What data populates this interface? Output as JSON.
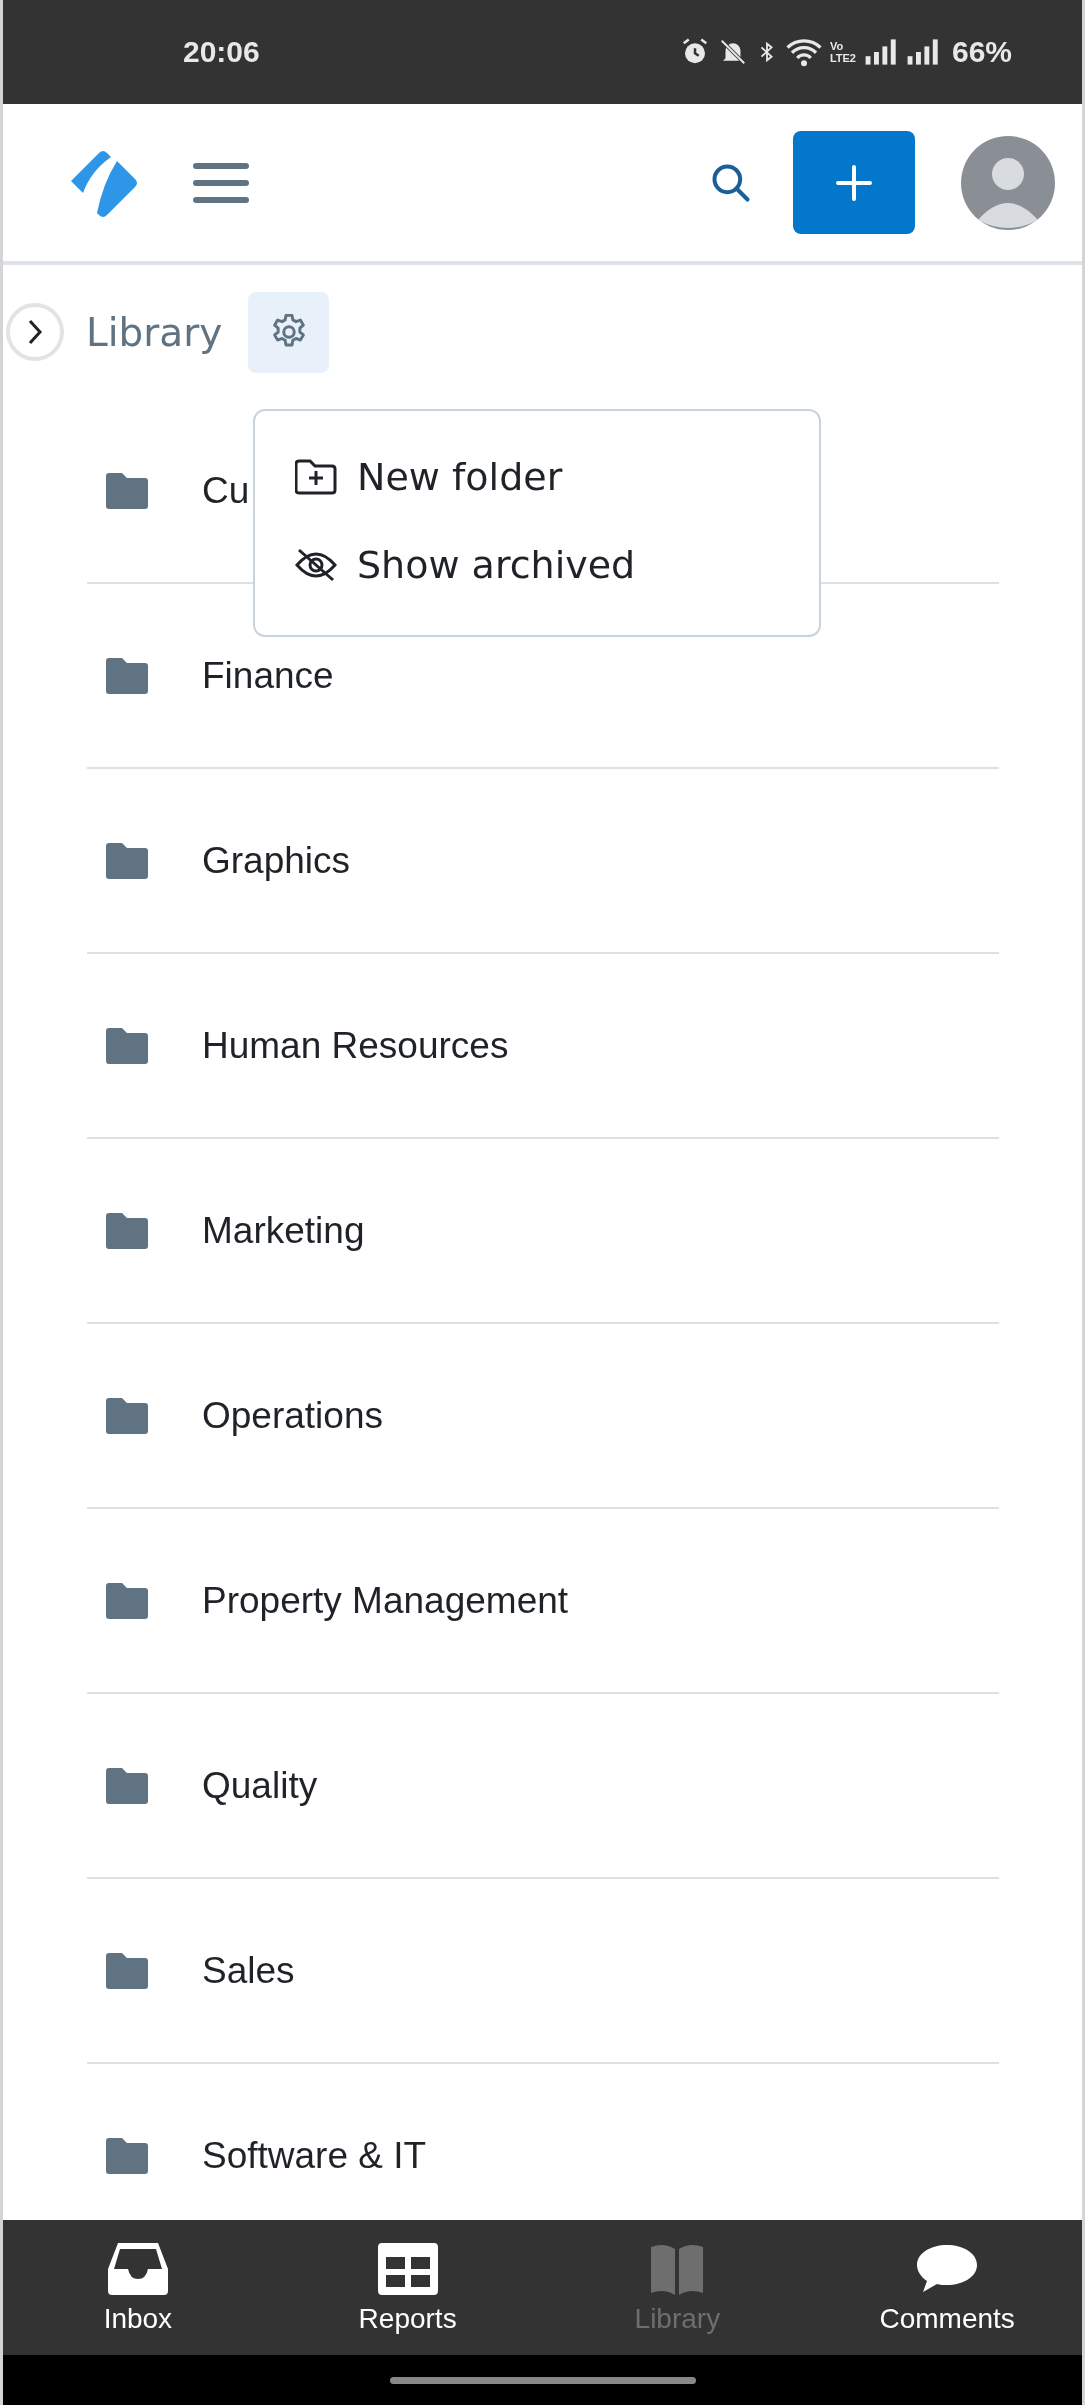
{
  "status_bar": {
    "time": "20:06",
    "network_label": [
      "Vo",
      "LTE2"
    ],
    "battery": "66%"
  },
  "breadcrumb": {
    "title": "Library"
  },
  "settings_menu": {
    "items": [
      {
        "kind": "new-folder",
        "label": "New folder"
      },
      {
        "kind": "archive",
        "label": "Show archived"
      }
    ]
  },
  "folders": [
    {
      "name": "Cu"
    },
    {
      "name": "Finance"
    },
    {
      "name": "Graphics"
    },
    {
      "name": "Human Resources"
    },
    {
      "name": "Marketing"
    },
    {
      "name": "Operations"
    },
    {
      "name": "Property Management"
    },
    {
      "name": "Quality"
    },
    {
      "name": "Sales"
    },
    {
      "name": "Software & IT"
    }
  ],
  "bottom_nav": [
    {
      "kind": "inbox",
      "label": "Inbox",
      "selected": false
    },
    {
      "kind": "reports",
      "label": "Reports",
      "selected": false
    },
    {
      "kind": "library",
      "label": "Library",
      "selected": true
    },
    {
      "kind": "comments",
      "label": "Comments",
      "selected": false
    }
  ]
}
